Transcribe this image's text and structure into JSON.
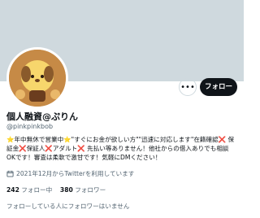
{
  "profile": {
    "display_name": "個人融資@ぷりん",
    "handle": "@pinkpinkbob",
    "bio": "⭐年中無休で営業中⭐\"すぐにお金が欲しい方\"\"迅速に対応します\"在籍確認❌ 保証金❌保証人❌アダルト❌ 先払い等ありません！他社からの借入ありでも相談OKです！審査は柔軟で激甘です！気軽にDMください！",
    "joined": "2021年12月からTwitterを利用しています",
    "following_count": "242",
    "following_label": "フォロー中",
    "followers_count": "380",
    "followers_label": "フォロワー",
    "mutual_followers_note": "フォローしている人にフォロワーはいません"
  },
  "actions": {
    "follow_label": "フォロー",
    "more_icon": "ellipsis-icon"
  },
  "icons": {
    "calendar": "calendar-icon"
  }
}
